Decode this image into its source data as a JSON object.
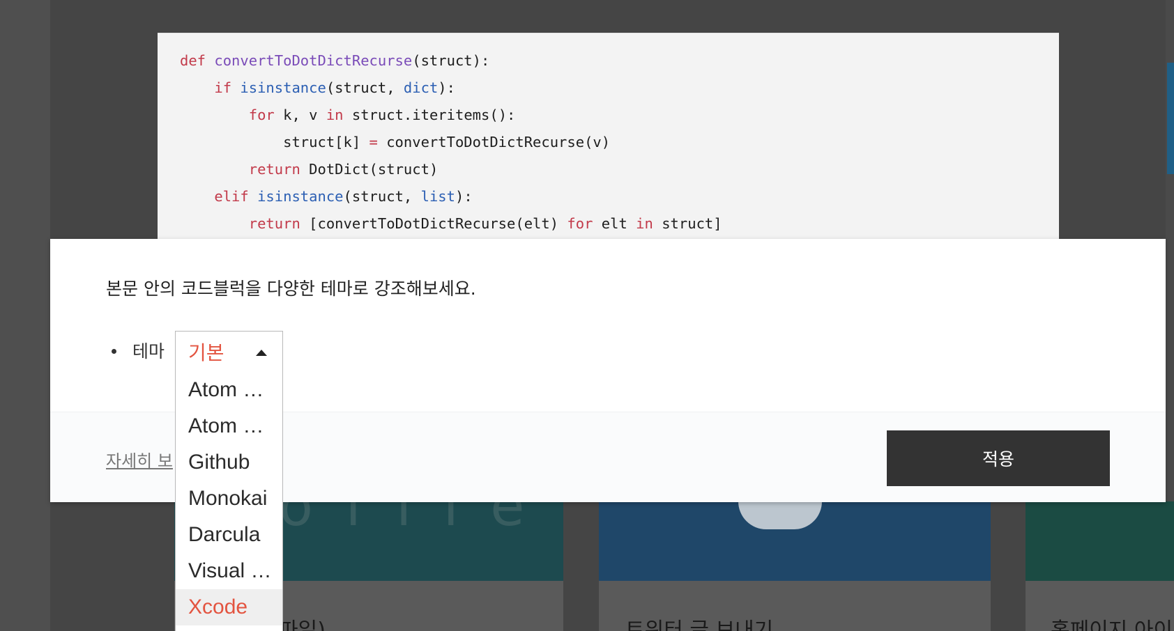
{
  "code_block": {
    "lines": [
      [
        {
          "t": "def",
          "c": "kw"
        },
        {
          "t": " "
        },
        {
          "t": "convertToDotDictRecurse",
          "c": "fn"
        },
        {
          "t": "(struct):"
        }
      ],
      [
        {
          "t": "    "
        },
        {
          "t": "if",
          "c": "kw"
        },
        {
          "t": " "
        },
        {
          "t": "isinstance",
          "c": "bi"
        },
        {
          "t": "(struct, "
        },
        {
          "t": "dict",
          "c": "bi"
        },
        {
          "t": "):"
        }
      ],
      [
        {
          "t": "        "
        },
        {
          "t": "for",
          "c": "kw"
        },
        {
          "t": " k, v "
        },
        {
          "t": "in",
          "c": "kw"
        },
        {
          "t": " struct.iteritems():"
        }
      ],
      [
        {
          "t": "            struct[k] "
        },
        {
          "t": "=",
          "c": "kw"
        },
        {
          "t": " convertToDotDictRecurse(v)"
        }
      ],
      [
        {
          "t": "        "
        },
        {
          "t": "return",
          "c": "kw"
        },
        {
          "t": " DotDict(struct)"
        }
      ],
      [
        {
          "t": "    "
        },
        {
          "t": "elif",
          "c": "kw"
        },
        {
          "t": " "
        },
        {
          "t": "isinstance",
          "c": "bi"
        },
        {
          "t": "(struct, "
        },
        {
          "t": "list",
          "c": "bi"
        },
        {
          "t": "):"
        }
      ],
      [
        {
          "t": "        "
        },
        {
          "t": "return",
          "c": "kw"
        },
        {
          "t": " [convertToDotDictRecurse(elt) "
        },
        {
          "t": "for",
          "c": "kw"
        },
        {
          "t": " elt "
        },
        {
          "t": "in",
          "c": "kw"
        },
        {
          "t": " struct]"
        }
      ]
    ]
  },
  "modal": {
    "description": "본문 안의 코드블럭을 다양한 테마로 강조해보세요.",
    "theme_label": "테마",
    "more_link": "자세히 보",
    "apply_label": "적용"
  },
  "dropdown": {
    "selected": "기본",
    "options": [
      "Atom One Dark",
      "Atom One Light",
      "Github",
      "Monokai",
      "Darcula",
      "Visual Studio",
      "Xcode"
    ],
    "active_option": "Xcode",
    "accent_color": "#e35440"
  },
  "background_cards": [
    {
      "title": "파일)"
    },
    {
      "title": "트위터 글 보내기"
    },
    {
      "title": "홈페이지 아이"
    }
  ],
  "colors": {
    "keyword": "#c23a4a",
    "function": "#7a4bb8",
    "builtin": "#2c5fb3",
    "apply_button": "#333333"
  }
}
